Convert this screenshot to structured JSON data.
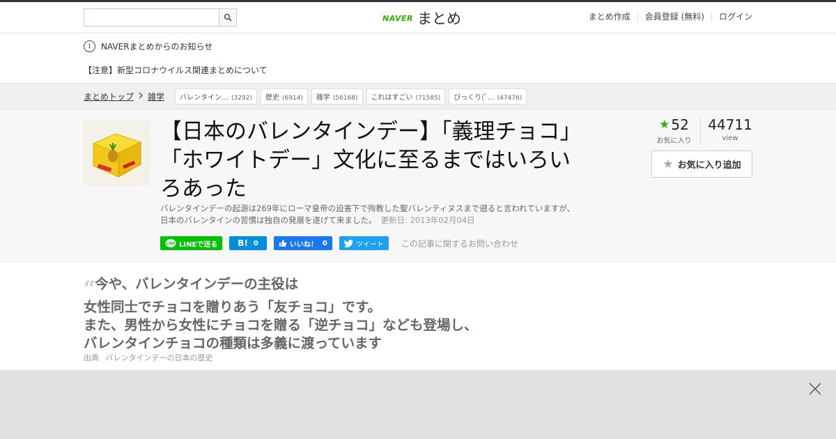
{
  "header": {
    "search_placeholder": "",
    "logo_brand": "NAVER",
    "logo_name": "まとめ",
    "nav": [
      "まとめ作成",
      "会員登録 (無料)",
      "ログイン"
    ]
  },
  "notice": {
    "heading": "NAVERまとめからのお知らせ",
    "link": "【注意】新型コロナウイルス関連まとめについて"
  },
  "breadcrumb": {
    "items": [
      "まとめトップ",
      "雑学"
    ],
    "tags": [
      {
        "label": "バレンタイン…",
        "count": "(3292)"
      },
      {
        "label": "歴史",
        "count": "(6914)"
      },
      {
        "label": "雑学",
        "count": "(56168)"
      },
      {
        "label": "これはすごい",
        "count": "(71585)"
      },
      {
        "label": "びっくり(ﾟ…",
        "count": "(47476)"
      }
    ]
  },
  "article": {
    "title": "【日本のバレンタインデー】「義理チョコ」「ホワイトデー」文化に至るまではいろいろあった",
    "description": "バレンタインデーの起源は269年にローマ皇帝の迫害下で殉教した聖バレンティヌスまで遡ると言われていますが、日本のバレンタインの習慣は独自の発展を遂げて来ました。",
    "updated": "更新日: 2013年02月04日",
    "favorites": "52",
    "favorites_label": "お気に入り",
    "views": "44711",
    "views_label": "view",
    "fav_button": "お気に入り追加",
    "inquiry": "この記事に関するお問い合わせ"
  },
  "share": {
    "line": "LINEで送る",
    "hatena_count": "0",
    "fb_label": "いいね！",
    "fb_count": "0",
    "tweet": "ツイート"
  },
  "quote": {
    "lines": [
      "今や、バレンタインデーの主役は",
      "女性同士でチョコを贈りあう「友チョコ」です。",
      "また、男性から女性にチョコを贈る「逆チョコ」なども登場し、",
      "バレンタインチョコの種類は多義に渡っています"
    ],
    "source_label": "出典",
    "source_link": "バレンタインデーの日本の歴史"
  },
  "colors": {
    "brand_green": "#2db400",
    "line_green": "#00c300",
    "hatena_blue": "#008fde",
    "fb_blue": "#1877f2",
    "twitter_blue": "#1da1f2"
  },
  "icons": [
    "search-icon",
    "info-icon",
    "chevron-right-icon",
    "star-icon",
    "line-icon",
    "hatena-icon",
    "facebook-like-icon",
    "twitter-icon",
    "close-icon"
  ]
}
